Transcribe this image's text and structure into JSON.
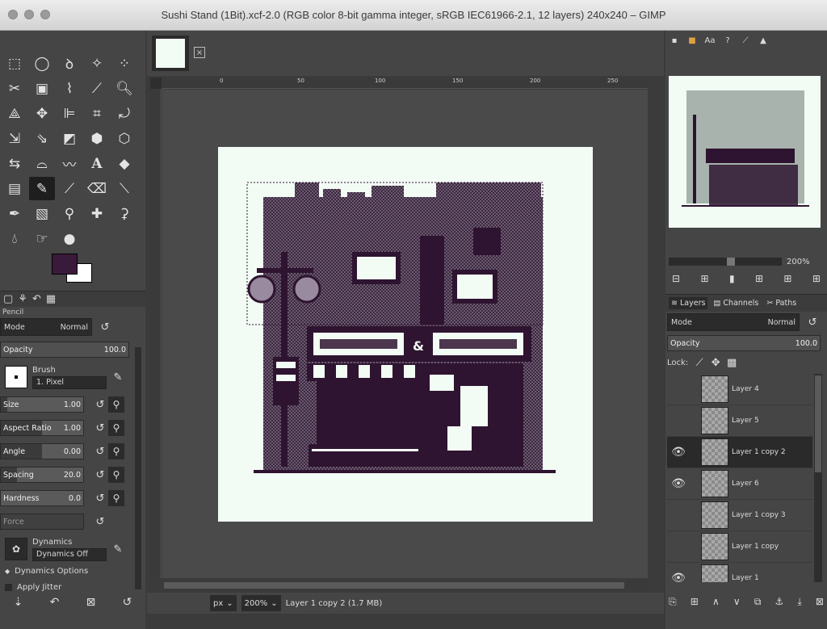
{
  "window": {
    "title": "Sushi Stand (1Bit).xcf-2.0 (RGB color 8-bit gamma integer, sRGB IEC61966-2.1, 12 layers) 240x240 – GIMP"
  },
  "colors": {
    "foreground": "#3a1a3a",
    "background": "#ffffff",
    "image_bg": "#f3fbf5",
    "ink": "#2e1430"
  },
  "tool_options": {
    "tool_name": "Pencil",
    "mode_label": "Mode",
    "mode_value": "Normal",
    "opacity_label": "Opacity",
    "opacity_value": "100.0",
    "brush_label": "Brush",
    "brush_value": "1. Pixel",
    "size_label": "Size",
    "size_value": "1.00",
    "aspect_label": "Aspect Ratio",
    "aspect_value": "1.00",
    "angle_label": "Angle",
    "angle_value": "0.00",
    "spacing_label": "Spacing",
    "spacing_value": "20.0",
    "hardness_label": "Hardness",
    "hardness_value": "0.0",
    "force_label": "Force",
    "dynamics_label": "Dynamics",
    "dynamics_value": "Dynamics Off",
    "dynamics_options": "Dynamics Options",
    "apply_jitter": "Apply Jitter"
  },
  "ruler": {
    "ticks": [
      "0",
      "50",
      "100",
      "150",
      "200",
      "250"
    ]
  },
  "status": {
    "unit": "px",
    "zoom": "200%",
    "message": "Layer 1 copy 2 (1.7 MB)"
  },
  "navigator": {
    "zoom": "200%"
  },
  "layers_panel": {
    "tab_layers": "Layers",
    "tab_channels": "Channels",
    "tab_paths": "Paths",
    "mode_label": "Mode",
    "mode_value": "Normal",
    "opacity_label": "Opacity",
    "opacity_value": "100.0",
    "lock_label": "Lock:",
    "layers": [
      {
        "name": "Layer 4",
        "visible": false,
        "selected": false
      },
      {
        "name": "Layer 5",
        "visible": false,
        "selected": false
      },
      {
        "name": "Layer 1 copy 2",
        "visible": true,
        "selected": true
      },
      {
        "name": "Layer 6",
        "visible": true,
        "selected": false
      },
      {
        "name": "Layer 1 copy 3",
        "visible": false,
        "selected": false
      },
      {
        "name": "Layer 1 copy",
        "visible": false,
        "selected": false
      },
      {
        "name": "Layer 1",
        "visible": true,
        "selected": false
      }
    ]
  }
}
